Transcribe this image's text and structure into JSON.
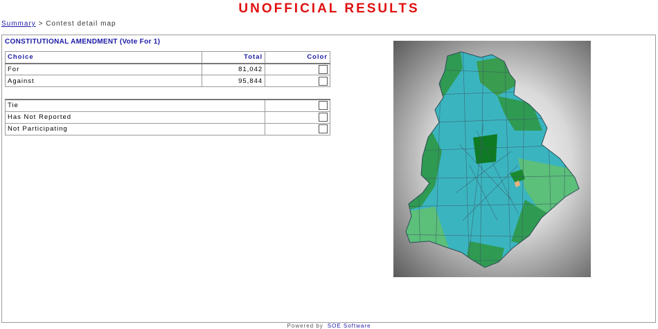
{
  "header": {
    "title": "UNOFFICIAL RESULTS"
  },
  "breadcrumb": {
    "link": "Summary",
    "separator": " > ",
    "current": "Contest detail map"
  },
  "contest": {
    "title": "CONSTITUTIONAL AMENDMENT (Vote For 1)",
    "columns": {
      "choice": "Choice",
      "total": "Total",
      "color": "Color"
    },
    "choices": [
      {
        "name": "For",
        "total": "81,042"
      },
      {
        "name": "Against",
        "total": "95,844"
      }
    ],
    "statuses": [
      {
        "name": "Tie"
      },
      {
        "name": "Has Not Reported"
      },
      {
        "name": "Not Participating"
      }
    ]
  },
  "map": {
    "legend_colors": {
      "for": "#2f9a52",
      "against": "#3ab5c0",
      "tie": "#f0b080"
    }
  },
  "footer": {
    "text": "Powered by",
    "link": "SOE Software"
  }
}
